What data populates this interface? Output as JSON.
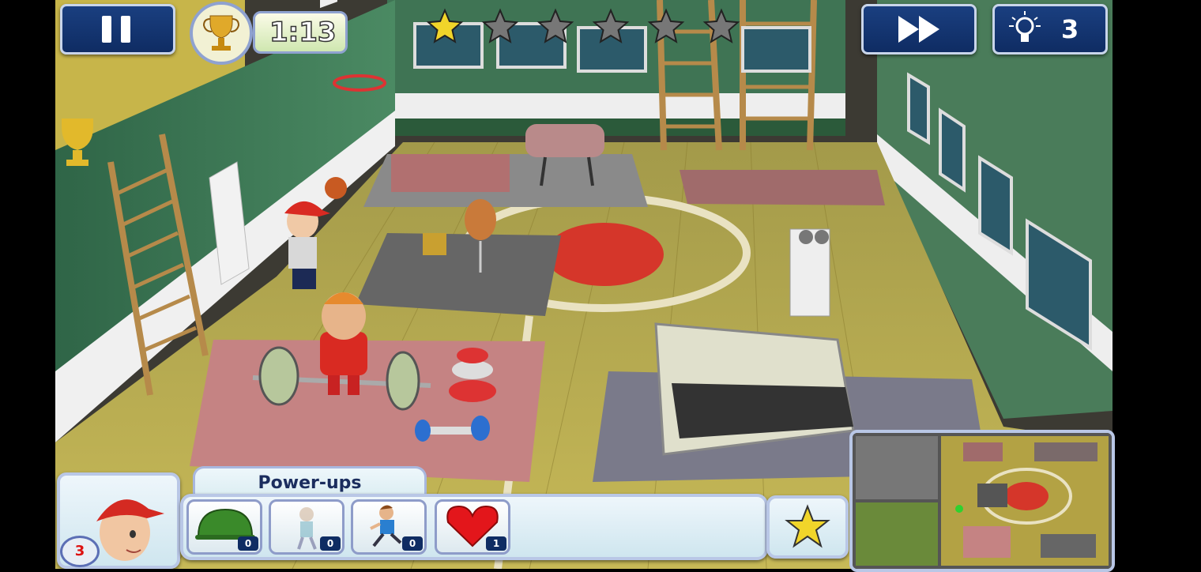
{
  "hud": {
    "timer": "1:13",
    "hint_count": "3",
    "stars_total": 6,
    "stars_earned": 1
  },
  "powerups": {
    "title": "Power-ups",
    "items": [
      {
        "icon": "helmet-icon",
        "count": "0"
      },
      {
        "icon": "walking-kid-icon",
        "count": "0"
      },
      {
        "icon": "running-kid-icon",
        "count": "0"
      },
      {
        "icon": "heart-icon",
        "count": "1"
      }
    ]
  },
  "player": {
    "lives": "3"
  },
  "colors": {
    "hud_blue": "#0f2c63",
    "hud_border": "#c9d5ea",
    "panel_light": "#dff0f5",
    "floor": "#b8a848",
    "wall": "#3f7a56",
    "star_gold": "#f1d52a",
    "star_gray": "#777777"
  }
}
